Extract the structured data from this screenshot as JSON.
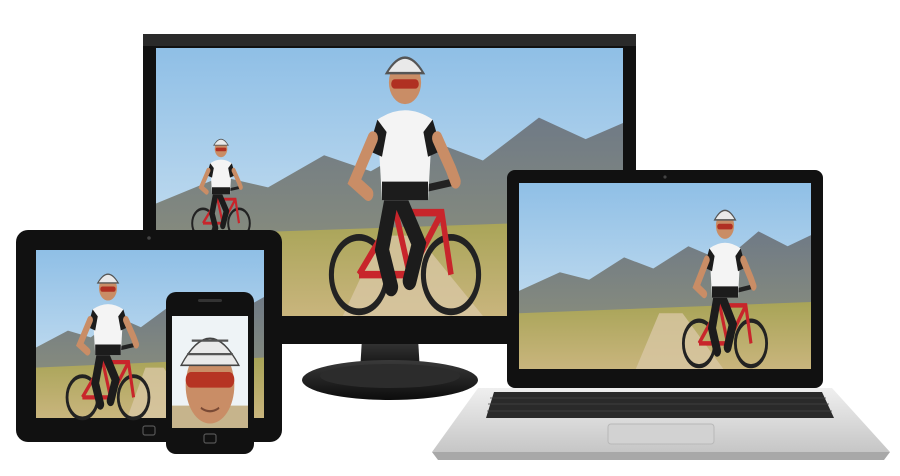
{
  "scene": {
    "description_hidden": "",
    "devices": [
      {
        "name": "desktop-monitor"
      },
      {
        "name": "laptop"
      },
      {
        "name": "tablet"
      },
      {
        "name": "smartphone"
      }
    ],
    "colors": {
      "device_frame": "#111111",
      "screen_border": "#222222",
      "laptop_body": "#d9d9d9",
      "sky": "#9ec9ea",
      "mountain": "#7a8796",
      "grass": "#9a9a48",
      "road": "#d9c7a3",
      "jersey_white": "#f4f4f4",
      "jersey_black": "#1c1c1c",
      "bike_red": "#c8252b",
      "helmet": "#e9e9e9",
      "skin": "#c98d66"
    }
  }
}
